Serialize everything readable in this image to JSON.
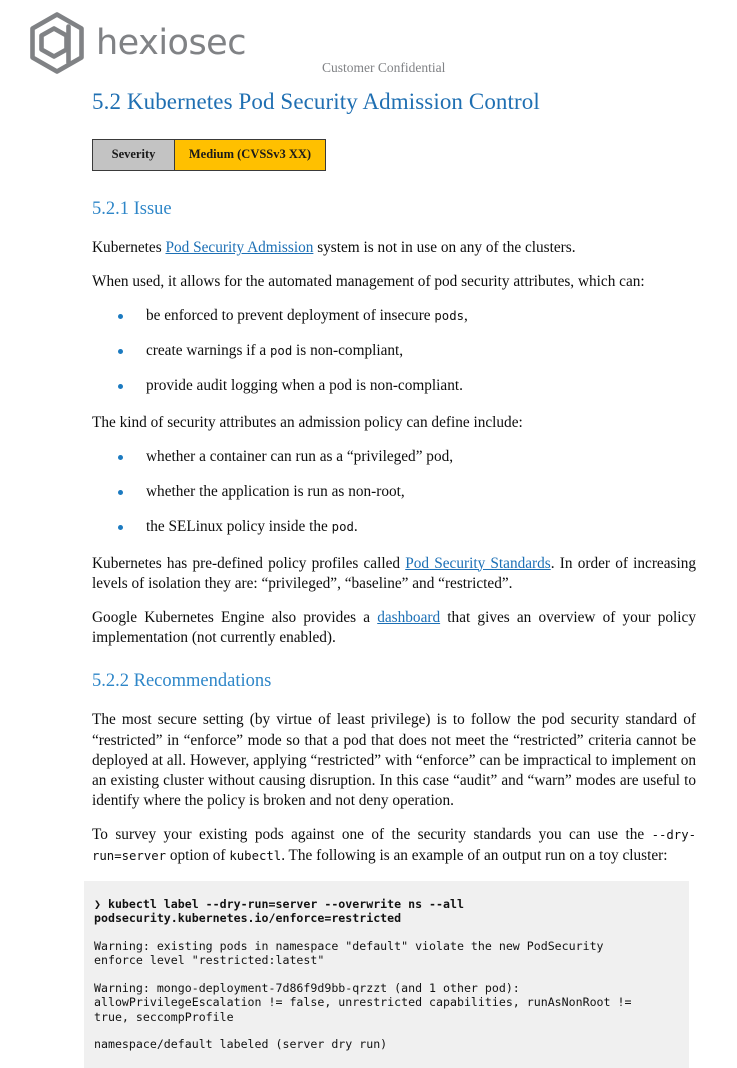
{
  "header": {
    "brand_name": "hexiosec",
    "logo_icon": "hexagon-p-logo-icon",
    "confidentiality_notice": "Customer Confidential"
  },
  "section": {
    "number": "5.2",
    "title": "5.2 Kubernetes Pod Security Admission Control"
  },
  "severity": {
    "label": "Severity",
    "value": "Medium (CVSSv3 XX)",
    "label_bg": "#C3C3C3",
    "value_bg": "#FFC000",
    "border_color": "#3A3A3A"
  },
  "issue": {
    "heading": "5.2.1 Issue",
    "intro_before_link": "Kubernetes ",
    "intro_link": "Pod Security Admission",
    "intro_after_link": " system is not in use on any of the clusters.",
    "when_used": "When used, it allows for the automated management of pod security attributes, which can:",
    "capabilities": [
      {
        "text_before": "be enforced to prevent deployment of insecure ",
        "code": "pods",
        "text_after": ","
      },
      {
        "text_before": "create warnings if a ",
        "code": "pod",
        "text_after": " is non-compliant,"
      },
      {
        "text_before": "provide audit logging when a pod is non-compliant.",
        "code": "",
        "text_after": ""
      }
    ],
    "attributes_intro": "The kind of security attributes an admission policy can define include:",
    "attributes": [
      {
        "text_before": "whether a container can run as a “privileged” pod",
        "code": "",
        "text_after": ","
      },
      {
        "text_before": "whether the application is run as non-root,",
        "code": "",
        "text_after": ""
      },
      {
        "text_before": "the SELinux policy inside the ",
        "code": "pod",
        "text_after": "."
      }
    ],
    "standards_before_link": "Kubernetes has pre-defined policy profiles called ",
    "standards_link": "Pod Security Standards",
    "standards_after_link": ". In order of increasing levels of isolation they are: “privileged”, “baseline” and “restricted”.",
    "gke_before_link": "Google Kubernetes Engine also provides a ",
    "gke_link": "dashboard",
    "gke_after_link": " that gives an overview of your policy implementation (not currently enabled)."
  },
  "recommendations": {
    "heading": "5.2.2 Recommendations",
    "paragraph_1": "The most secure setting (by virtue of least privilege) is to follow the pod security standard of “restricted” in “enforce” mode so that a pod that does not meet the “restricted” criteria cannot be deployed at all. However, applying “restricted” with “enforce” can be impractical to implement on an existing cluster without causing disruption. In this case “audit” and “warn” modes are useful to identify where the policy is broken and not deny operation.",
    "survey_part_1": "To survey your existing pods against one of the security standards you can use the ",
    "survey_code_1": "--dry-run=server",
    "survey_part_2": " option of ",
    "survey_code_2": "kubectl",
    "survey_part_3": ". The following is an example of an output run on a toy cluster:"
  },
  "code_block": {
    "background": "#F0F0F0",
    "command": "❯ kubectl label --dry-run=server --overwrite ns --all\npodsecurity.kubernetes.io/enforce=restricted",
    "output_1": "Warning: existing pods in namespace \"default\" violate the new PodSecurity\nenforce level \"restricted:latest\"",
    "output_2": "Warning: mongo-deployment-7d86f9d9bb-qrzzt (and 1 other pod):\nallowPrivilegeEscalation != false, unrestricted capabilities, runAsNonRoot !=\ntrue, seccompProfile",
    "output_3": "namespace/default labeled (server dry run)"
  },
  "colors": {
    "heading_blue": "#1F6FB2",
    "subheading_blue": "#2E86C8",
    "link_blue": "#1B6FB5",
    "bullet_blue": "#1B7AC0",
    "brand_gray": "#808285"
  }
}
